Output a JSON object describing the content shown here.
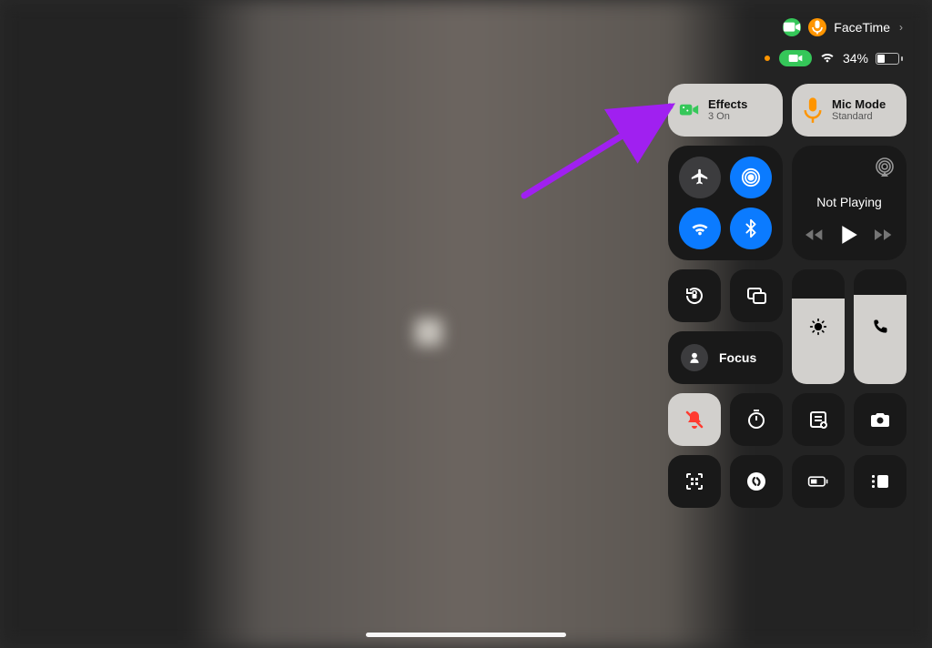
{
  "statusbar": {
    "app": "FaceTime",
    "battery_percent": "34%"
  },
  "effects": {
    "title": "Effects",
    "sub": "3 On"
  },
  "mic_mode": {
    "title": "Mic Mode",
    "sub": "Standard"
  },
  "media": {
    "now_playing": "Not Playing"
  },
  "focus": {
    "label": "Focus"
  },
  "sliders": {
    "brightness_percent": 75,
    "volume_percent": 78
  },
  "colors": {
    "accent_green": "#35c759",
    "accent_orange": "#ff9500",
    "accent_blue": "#0b7bff",
    "arrow": "#a020f0"
  }
}
